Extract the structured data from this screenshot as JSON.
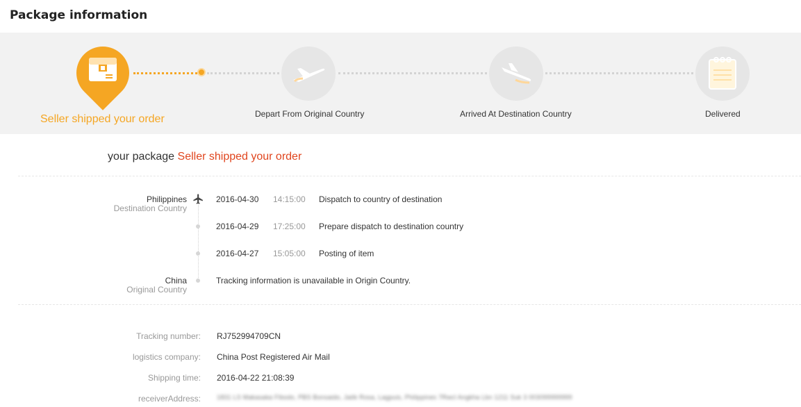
{
  "title": "Package information",
  "steps": [
    {
      "label": "Seller shipped your order",
      "icon": "package-box-icon",
      "active": true
    },
    {
      "label": "Depart From Original Country",
      "icon": "departing-plane-icon",
      "active": false
    },
    {
      "label": "Arrived At Destination Country",
      "icon": "landing-plane-icon",
      "active": false
    },
    {
      "label": "Delivered",
      "icon": "notepad-icon",
      "active": false
    }
  ],
  "status": {
    "prefix": "your package",
    "value": "Seller shipped your order"
  },
  "locations": {
    "destination": {
      "name": "Philippines",
      "sub": "Destination Country"
    },
    "origin": {
      "name": "China",
      "sub": "Original Country"
    }
  },
  "events": [
    {
      "date": "2016-04-30",
      "time": "14:15:00",
      "desc": "Dispatch to country of destination"
    },
    {
      "date": "2016-04-29",
      "time": "17:25:00",
      "desc": "Prepare dispatch to destination country"
    },
    {
      "date": "2016-04-27",
      "time": "15:05:00",
      "desc": "Posting of item"
    }
  ],
  "origin_note": "Tracking information is unavailable in Origin Country.",
  "info": {
    "tracking": {
      "label": "Tracking number:",
      "value": "RJ752994709CN"
    },
    "company": {
      "label": "logistics company:",
      "value": "China Post Registered Air Mail"
    },
    "shipping": {
      "label": "Shipping time:",
      "value": "2016-04-22 21:08:39"
    },
    "address": {
      "label": "receiverAddress:",
      "value": "1831 LS Makasaka Fibodo, PBS Bonsaido, Jatik Rosa, Lagpuis, Philippines 7Rwcl Angkha Lbn 1211 Suk 3 003099999999"
    }
  },
  "colors": {
    "accent": "#f5a623",
    "highlight": "#e0451e",
    "panel": "#f2f2f2"
  }
}
